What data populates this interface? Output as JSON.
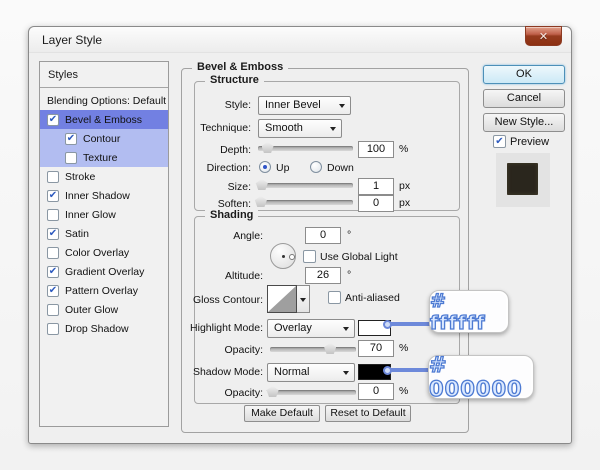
{
  "window": {
    "title": "Layer Style",
    "close_glyph": "✕"
  },
  "icons": {
    "check": "✔",
    "close": "✕",
    "dropdown_arrow": "▼"
  },
  "sidebar": {
    "header": "Styles",
    "items": [
      {
        "label": "Blending Options: Default"
      },
      {
        "label": "Bevel & Emboss",
        "checked": true,
        "state": "selected"
      },
      {
        "label": "Contour",
        "checked": true,
        "state": "sub",
        "indent": true
      },
      {
        "label": "Texture",
        "checked": false,
        "state": "sub",
        "indent": true
      },
      {
        "label": "Stroke",
        "checked": false
      },
      {
        "label": "Inner Shadow",
        "checked": true
      },
      {
        "label": "Inner Glow",
        "checked": false
      },
      {
        "label": "Satin",
        "checked": true
      },
      {
        "label": "Color Overlay",
        "checked": false
      },
      {
        "label": "Gradient Overlay",
        "checked": true
      },
      {
        "label": "Pattern Overlay",
        "checked": true
      },
      {
        "label": "Outer Glow",
        "checked": false
      },
      {
        "label": "Drop Shadow",
        "checked": false
      }
    ]
  },
  "main": {
    "group_title": "Bevel & Emboss",
    "structure": {
      "title": "Structure",
      "style_label": "Style:",
      "style_value": "Inner Bevel",
      "technique_label": "Technique:",
      "technique_value": "Smooth",
      "depth_label": "Depth:",
      "depth_value": "100",
      "depth_unit": "%",
      "direction_label": "Direction:",
      "direction_up": "Up",
      "direction_down": "Down",
      "size_label": "Size:",
      "size_value": "1",
      "size_unit": "px",
      "soften_label": "Soften:",
      "soften_value": "0",
      "soften_unit": "px"
    },
    "shading": {
      "title": "Shading",
      "angle_label": "Angle:",
      "angle_value": "0",
      "angle_unit": "°",
      "use_global_light_label": "Use Global Light",
      "altitude_label": "Altitude:",
      "altitude_value": "26",
      "altitude_unit": "°",
      "gloss_contour_label": "Gloss Contour:",
      "anti_aliased_label": "Anti-aliased",
      "highlight_mode_label": "Highlight Mode:",
      "highlight_mode_value": "Overlay",
      "highlight_opacity_label": "Opacity:",
      "highlight_opacity_value": "70",
      "highlight_opacity_unit": "%",
      "shadow_mode_label": "Shadow Mode:",
      "shadow_mode_value": "Normal",
      "shadow_opacity_label": "Opacity:",
      "shadow_opacity_value": "0",
      "shadow_opacity_unit": "%",
      "highlight_color": "#ffffff",
      "shadow_color": "#000000"
    },
    "footer": {
      "make_default": "Make Default",
      "reset_to_default": "Reset to Default"
    }
  },
  "actions": {
    "ok": "OK",
    "cancel": "Cancel",
    "new_style": "New Style...",
    "preview": "Preview"
  },
  "callouts": {
    "highlight_hex": "# ffffff",
    "shadow_hex": "# 000000"
  },
  "sliders": {
    "depth_percent": 10,
    "size_percent": 4,
    "soften_percent": 3,
    "highlight_opacity_percent": 70,
    "shadow_opacity_percent": 3
  },
  "colors": {
    "selected_row": "#7280e2",
    "sub_row": "#b2bdf1",
    "preview_swatch": "#2a261d",
    "callout_stroke": "#4d7ad2"
  }
}
